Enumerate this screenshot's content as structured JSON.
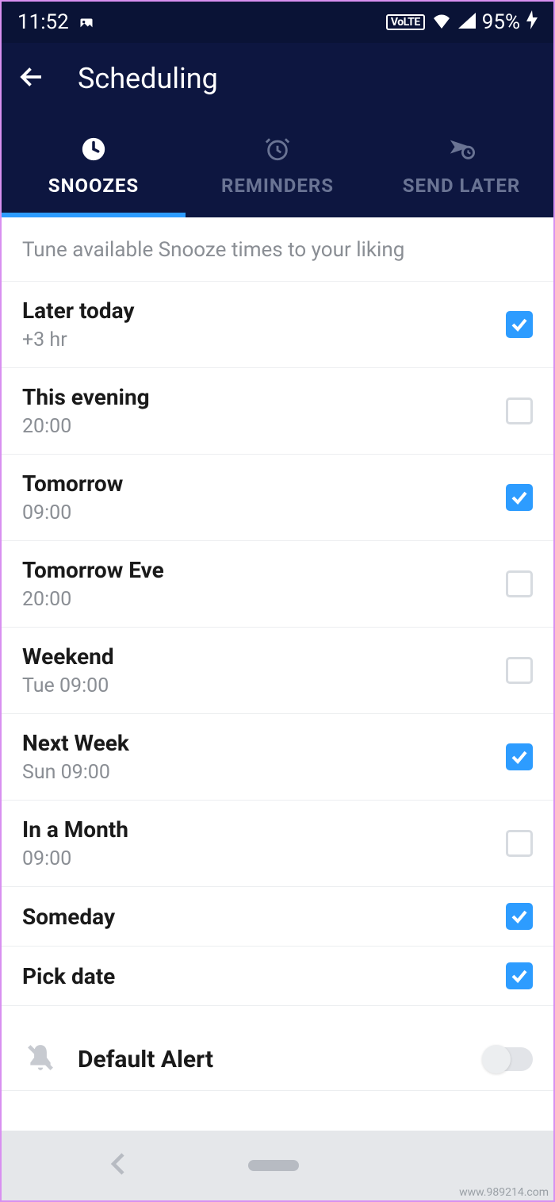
{
  "statusbar": {
    "time": "11:52",
    "volte": "VoLTE",
    "battery": "95%"
  },
  "appbar": {
    "title": "Scheduling"
  },
  "tabs": [
    {
      "label": "SNOOZES",
      "icon": "clock-icon",
      "active": true
    },
    {
      "label": "REMINDERS",
      "icon": "alarm-icon",
      "active": false
    },
    {
      "label": "SEND LATER",
      "icon": "send-later-icon",
      "active": false
    }
  ],
  "hint": "Tune available Snooze times to your liking",
  "snooze_options": [
    {
      "title": "Later today",
      "sub": "+3 hr",
      "checked": true
    },
    {
      "title": "This evening",
      "sub": "20:00",
      "checked": false
    },
    {
      "title": "Tomorrow",
      "sub": "09:00",
      "checked": true
    },
    {
      "title": "Tomorrow Eve",
      "sub": "20:00",
      "checked": false
    },
    {
      "title": "Weekend",
      "sub": "Tue 09:00",
      "checked": false
    },
    {
      "title": "Next Week",
      "sub": "Sun 09:00",
      "checked": true
    },
    {
      "title": "In a Month",
      "sub": "09:00",
      "checked": false
    },
    {
      "title": "Someday",
      "sub": "",
      "checked": true
    },
    {
      "title": "Pick date",
      "sub": "",
      "checked": true
    }
  ],
  "default_alert": {
    "label": "Default Alert",
    "enabled": false
  },
  "watermark": "www.989214.com"
}
